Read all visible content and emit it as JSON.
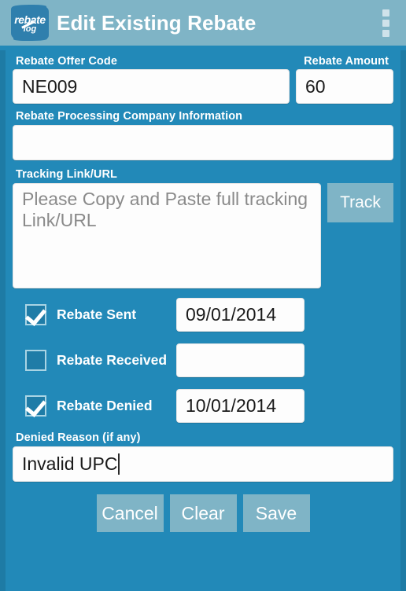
{
  "appbar": {
    "title": "Edit Existing Rebate",
    "logo_line1": "rebate",
    "logo_line2": "log",
    "overflow_label": "More options"
  },
  "form": {
    "offer_code": {
      "label": "Rebate Offer Code",
      "value": "NE009"
    },
    "amount": {
      "label": "Rebate Amount",
      "value": "60"
    },
    "company": {
      "label": "Rebate Processing Company Information",
      "value": ""
    },
    "tracking": {
      "label": "Tracking Link/URL",
      "value": "",
      "placeholder": "Please Copy and Paste full tracking Link/URL",
      "button_label": "Track"
    },
    "checkboxes": [
      {
        "label": "Rebate Sent",
        "checked": true,
        "date": "09/01/2014"
      },
      {
        "label": "Rebate Received",
        "checked": false,
        "date": ""
      },
      {
        "label": "Rebate Denied",
        "checked": true,
        "date": "10/01/2014"
      }
    ],
    "denied_reason": {
      "label": "Denied Reason (if any)",
      "value": "Invalid UPC"
    }
  },
  "buttons": {
    "cancel": "Cancel",
    "clear": "Clear",
    "save": "Save"
  },
  "colors": {
    "background": "#2289b8",
    "appbar": "#7fb4c6",
    "button": "#7fb4c6",
    "field_background": "#fdfdfd",
    "label_text": "#ffffff",
    "placeholder_text": "#8a8a8a",
    "checkbox_border": "#a9d4e4"
  }
}
